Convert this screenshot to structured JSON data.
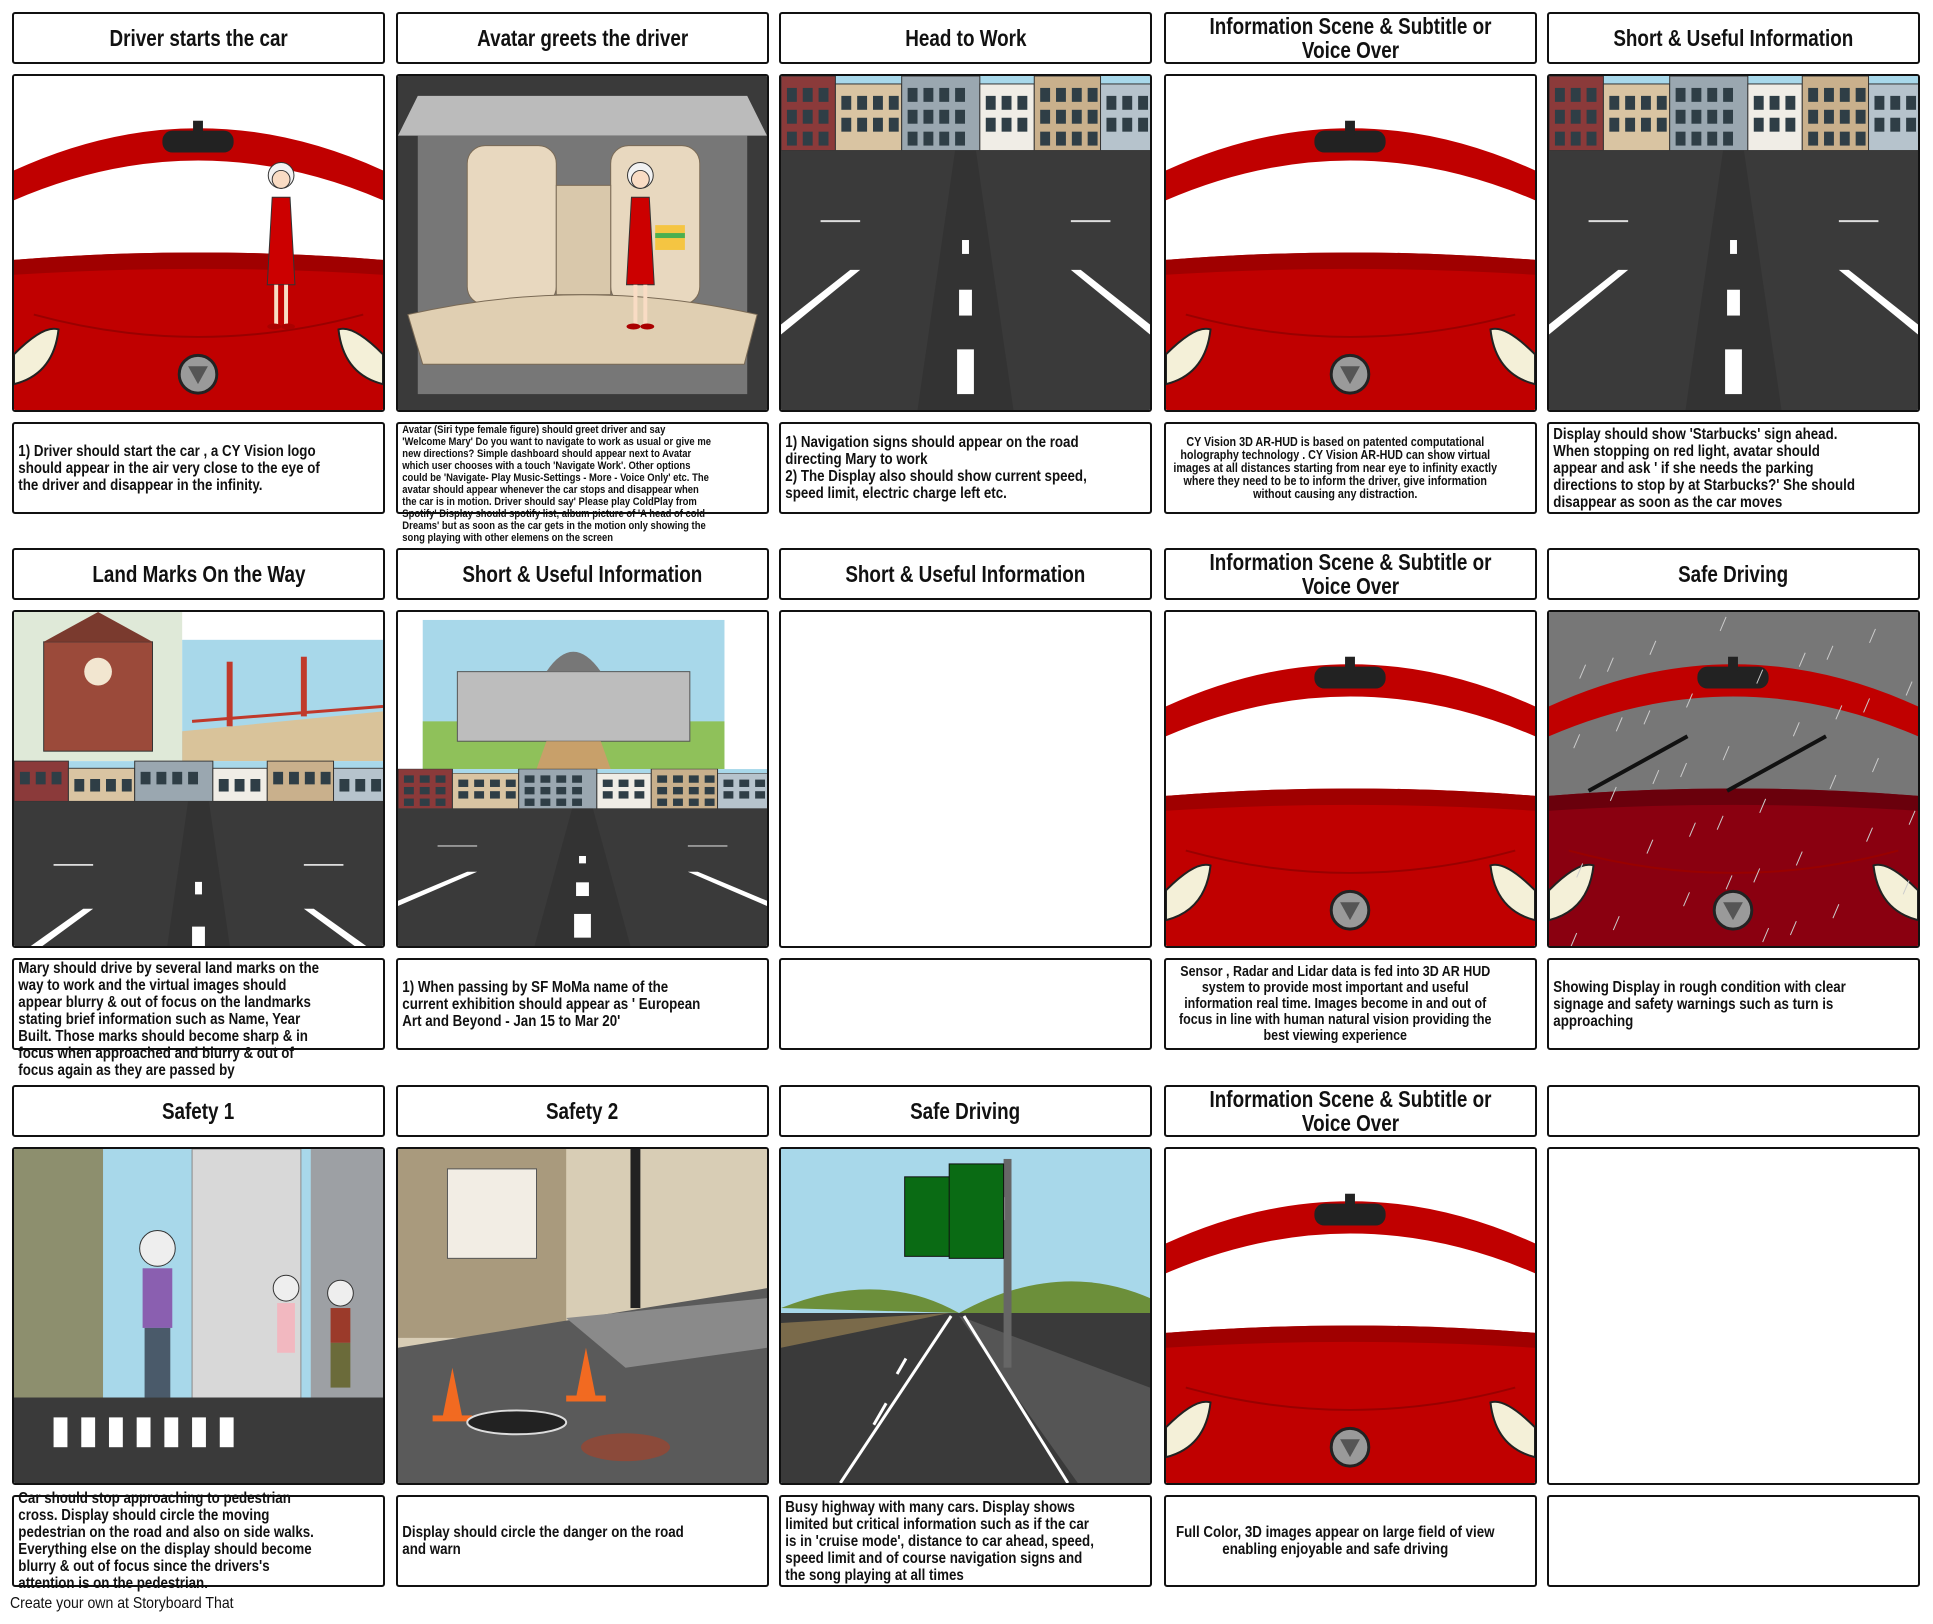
{
  "panels": [
    {
      "title": "Driver starts the car",
      "caption": "1) Driver should start the car , a CY Vision logo should appear in the air very close to the eye of the driver and disappear in the infinity."
    },
    {
      "title": "Avatar greets the driver",
      "caption": "Avatar (Siri type female figure) should greet driver and say 'Welcome Mary' Do you want to navigate to work as usual or give me new directions? Simple dashboard should appear next to Avatar which user chooses with a touch 'Navigate  Work'. Other options could be 'Navigate- Play Music-Settings - More - Voice Only' etc. The avatar should appear whenever the car stops and disappear when the car is in motion. Driver should say' Please play ColdPlay from Spotify' Display should spotify list, album picture of 'A head of cold Dreams' but as soon as the car gets in the motion only showing the song playing with other elemens on the screen"
    },
    {
      "title": "Head to Work",
      "caption": "1) Navigation signs should appear on the road directing Mary to work\n2) The Display also should show current speed, speed limit, electric charge left etc."
    },
    {
      "title": "Information Scene & Subtitle or Voice Over",
      "caption": "CY Vision 3D AR-HUD is based on patented computational holography technology . CY Vision AR-HUD can show virtual images at all distances starting from near eye to infinity exactly where they need to be to inform the driver, give information without causing any distraction."
    },
    {
      "title": "Short & Useful Information",
      "caption": "Display should show 'Starbucks' sign ahead. When stopping on red light, avatar should appear and ask ' if she needs the parking directions to stop by at Starbucks?' She should disappear as soon as the car moves"
    },
    {
      "title": "Land Marks On the Way",
      "caption": "Mary should drive by several land marks on the way to work and the virtual images should appear blurry & out  of focus on the landmarks stating brief information such as Name, Year Built. Those marks should become sharp & in focus when approached and blurry & out of focus again  as they are passed by"
    },
    {
      "title": "Short & Useful Information",
      "caption": "1) When passing by  SF MoMa name of the current exhibition should appear as ' European Art and Beyond - Jan 15 to Mar 20'"
    },
    {
      "title": "Short & Useful Information",
      "caption": ""
    },
    {
      "title": "Information Scene & Subtitle or Voice Over",
      "caption": "Sensor , Radar and Lidar data is fed into 3D AR HUD system to provide most important and useful information real time.  Images become in and out of focus in line with human natural vision providing the best viewing experience"
    },
    {
      "title": "Safe Driving",
      "caption": "Showing Display in rough condition with clear signage and safety warnings such as turn is approaching"
    },
    {
      "title": "Safety 1",
      "caption": "Car should stop approaching to pedestrian cross. Display should circle the moving pedestrian on the road and also on side walks. Everything else on the display should become blurry & out of focus since the drivers's attention is on the pedestrian."
    },
    {
      "title": "Safety 2",
      "caption": "Display should circle the danger on the road and warn"
    },
    {
      "title": "Safe Driving",
      "caption": "Busy highway with many cars. Display shows limited but critical information such as if the car is in 'cruise mode', distance to car ahead, speed, speed limit and of course navigation signs and the song playing at all times"
    },
    {
      "title": "Information Scene & Subtitle or Voice Over",
      "caption": "Full Color, 3D images appear on large field of view enabling enjoyable and safe driving"
    },
    {
      "title": "",
      "caption": ""
    }
  ],
  "footer": "Create your own at Storyboard That",
  "colors": {
    "car_red": "#c00000",
    "asphalt": "#3a3a3a",
    "sky": "#a8d8ea",
    "border": "#111111"
  }
}
